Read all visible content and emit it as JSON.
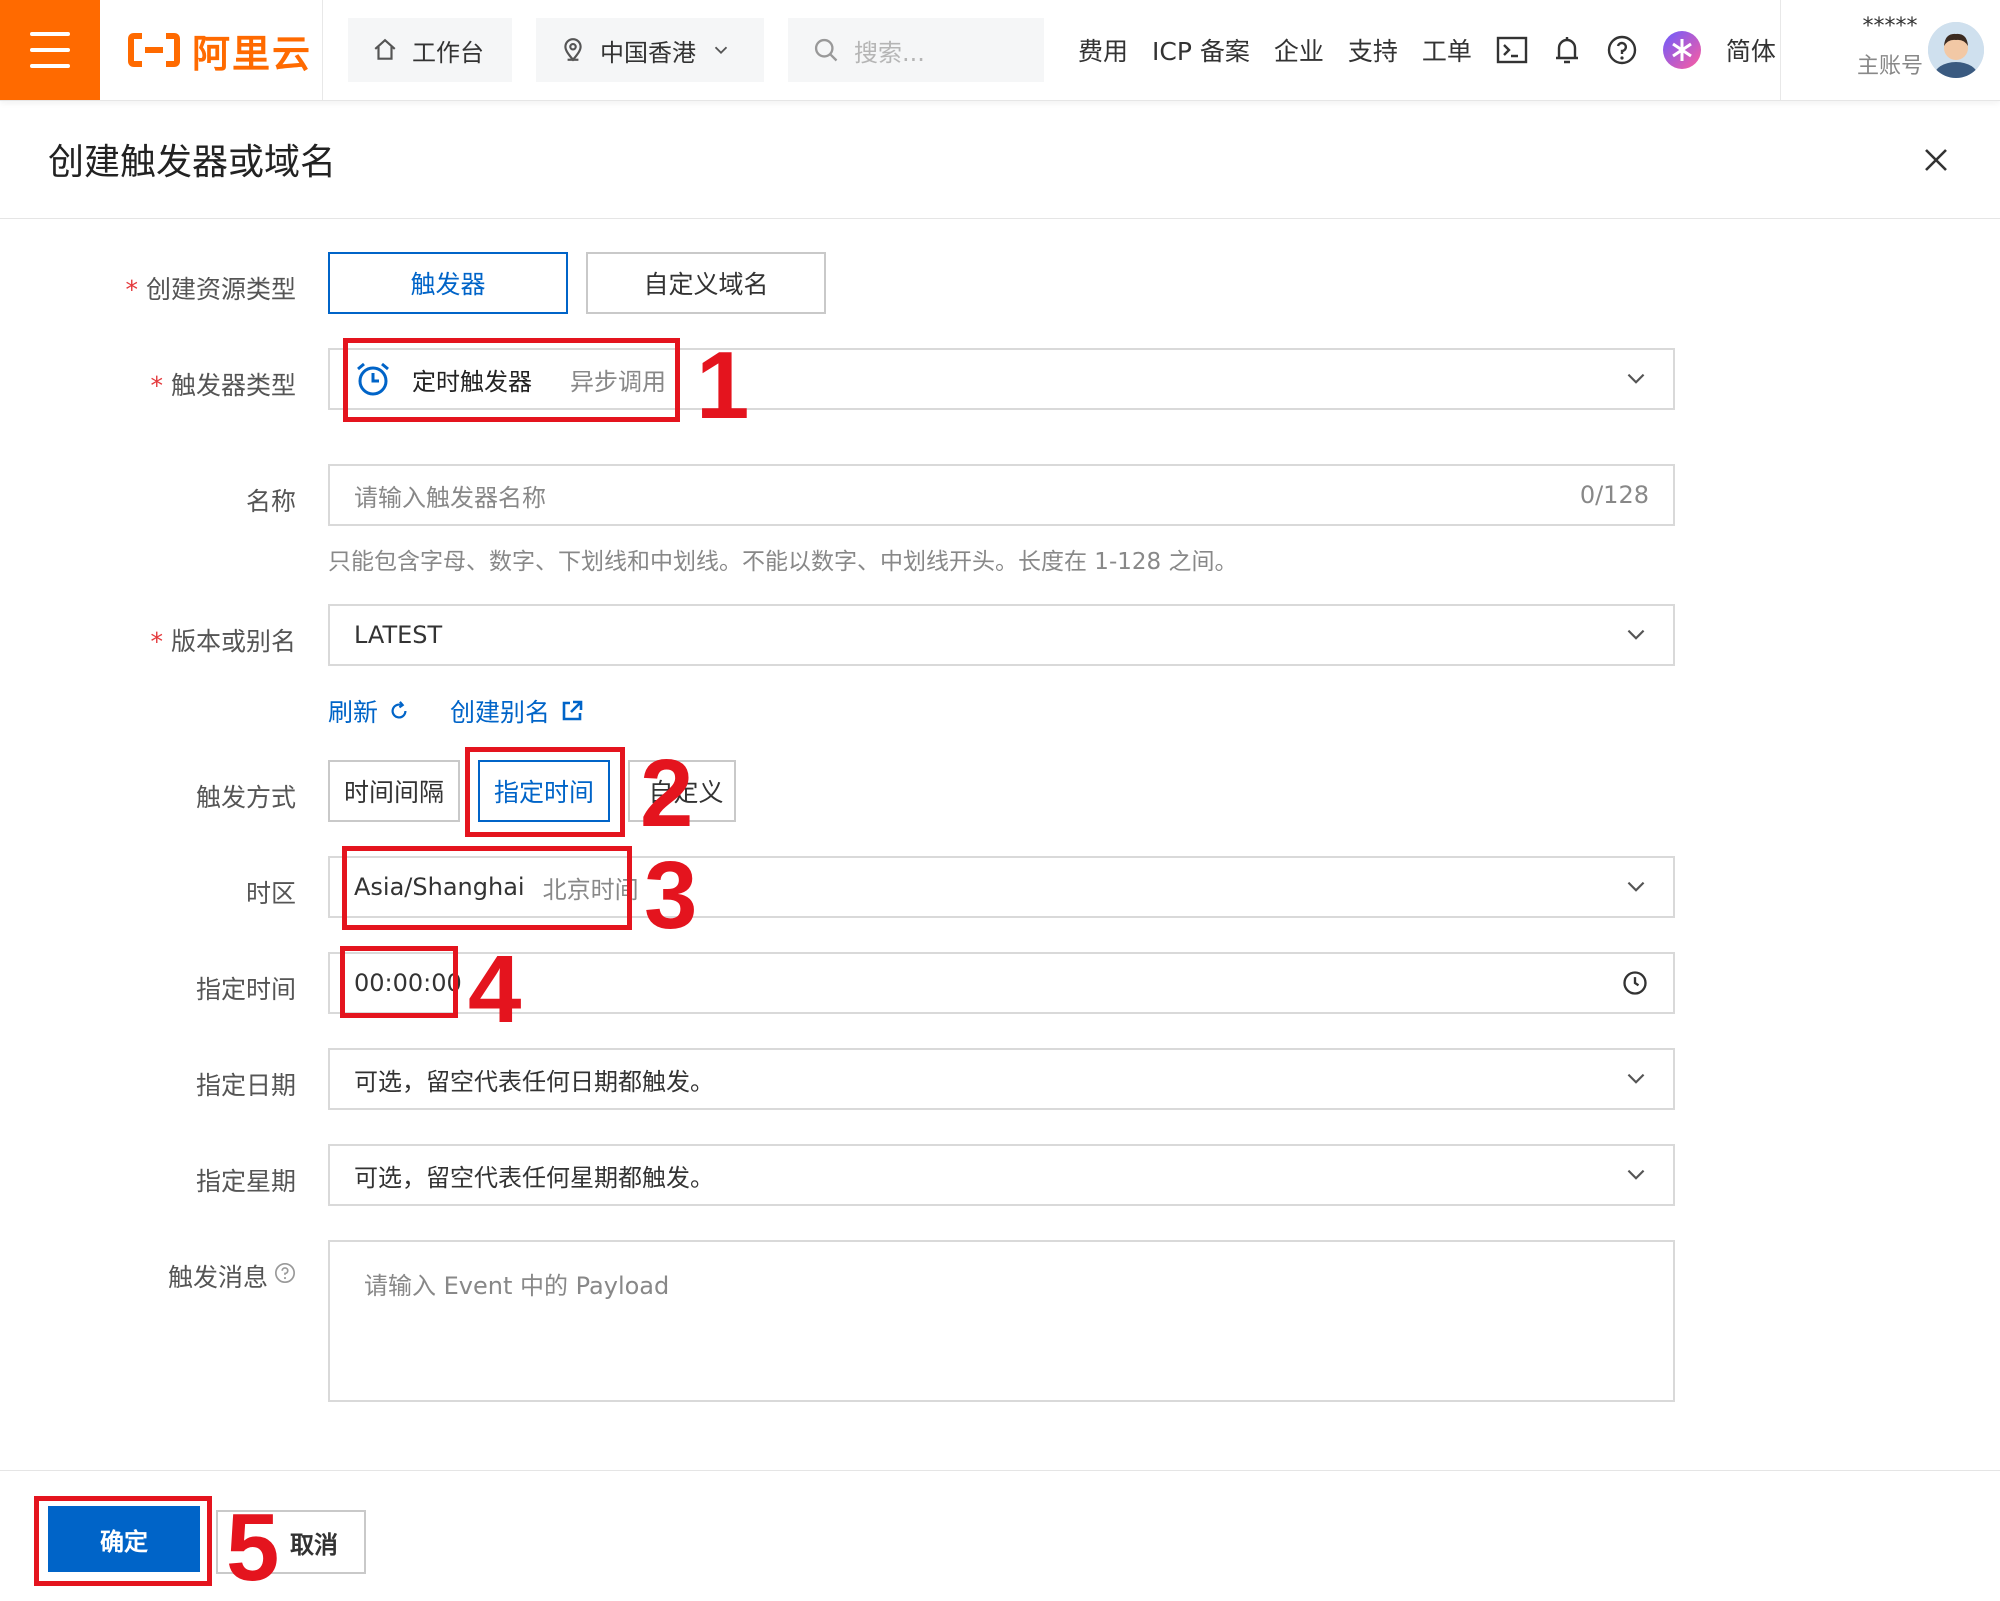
{
  "topbar": {
    "brand": "阿里云",
    "workbench": "工作台",
    "region": "中国香港",
    "search_placeholder": "搜索...",
    "links": [
      "费用",
      "ICP 备案",
      "企业",
      "支持",
      "工单"
    ],
    "language": "简体",
    "account_masked": "*****",
    "account_type": "主账号",
    "brand_color": "#ff6a00"
  },
  "drawer": {
    "title": "创建触发器或域名"
  },
  "form": {
    "resource_type": {
      "label": "创建资源类型",
      "options": [
        "触发器",
        "自定义域名"
      ],
      "selected": "触发器"
    },
    "trigger_type": {
      "label": "触发器类型",
      "value": "定时触发器",
      "sub": "异步调用",
      "icon": "alarm-clock-icon"
    },
    "name": {
      "label": "名称",
      "placeholder": "请输入触发器名称",
      "counter": "0/128",
      "hint": "只能包含字母、数字、下划线和中划线。不能以数字、中划线开头。长度在 1-128 之间。"
    },
    "version": {
      "label": "版本或别名",
      "value": "LATEST",
      "refresh": "刷新",
      "create_alias": "创建别名"
    },
    "trigger_mode": {
      "label": "触发方式",
      "options": [
        "时间间隔",
        "指定时间",
        "自定义"
      ],
      "selected": "指定时间"
    },
    "timezone": {
      "label": "时区",
      "value": "Asia/Shanghai",
      "sub": "北京时间"
    },
    "time": {
      "label": "指定时间",
      "value": "00:00:00"
    },
    "date": {
      "label": "指定日期",
      "placeholder": "可选，留空代表任何日期都触发。"
    },
    "weekday": {
      "label": "指定星期",
      "placeholder": "可选，留空代表任何星期都触发。"
    },
    "payload": {
      "label": "触发消息",
      "placeholder": "请输入 Event 中的 Payload"
    }
  },
  "footer": {
    "ok": "确定",
    "cancel": "取消"
  },
  "annotations": [
    "1",
    "2",
    "3",
    "4",
    "5"
  ],
  "colors": {
    "primary": "#0064c8",
    "annotation_red": "#e4141e",
    "required": "#e4393c"
  }
}
